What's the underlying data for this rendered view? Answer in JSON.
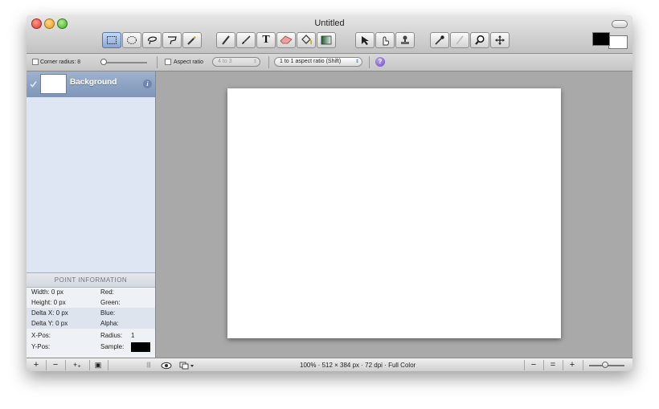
{
  "window": {
    "title": "Untitled"
  },
  "toolbar": {
    "tools": [
      {
        "name": "rect-select-tool-icon",
        "active": true
      },
      {
        "name": "ellipse-select-tool-icon"
      },
      {
        "name": "lasso-tool-icon"
      },
      {
        "name": "polygon-lasso-tool-icon"
      },
      {
        "name": "magic-wand-tool-icon"
      },
      {
        "name": "pencil-tool-icon"
      },
      {
        "name": "brush-tool-icon"
      },
      {
        "name": "text-tool-icon"
      },
      {
        "name": "eraser-tool-icon"
      },
      {
        "name": "paint-bucket-tool-icon"
      },
      {
        "name": "gradient-tool-icon"
      },
      {
        "name": "move-selection-tool-icon"
      },
      {
        "name": "smudge-tool-icon"
      },
      {
        "name": "stamp-tool-icon"
      },
      {
        "name": "eyedropper-tool-icon"
      },
      {
        "name": "retouch-brush-tool-icon"
      },
      {
        "name": "zoom-tool-icon"
      },
      {
        "name": "move-tool-icon"
      }
    ],
    "text_tool_glyph": "T",
    "foreground_color": "#000000",
    "background_color": "#ffffff"
  },
  "options": {
    "corner_radius_label": "Corner radius: 8",
    "aspect_ratio_label": "Aspect ratio",
    "aspect_ratio_value": "4 to 3",
    "ratio_mode_value": "1 to 1 aspect ratio (Shift)",
    "help_glyph": "?"
  },
  "layers": {
    "items": [
      {
        "name": "Background",
        "visible": true
      }
    ]
  },
  "point_info": {
    "header": "POINT INFORMATION",
    "width": "Width:  0 px",
    "height": "Height:  0 px",
    "delta_x": "Delta X: 0 px",
    "delta_y": "Delta Y: 0 px",
    "x_pos": "X-Pos:",
    "y_pos": "Y-Pos:",
    "red": "Red:",
    "green": "Green:",
    "blue": "Blue:",
    "alpha": "Alpha:",
    "radius": "Radius:",
    "radius_value": "1",
    "sample": "Sample:",
    "sample_color": "#000000"
  },
  "bottom": {
    "add": "+",
    "remove": "−",
    "duplicate": "+₊",
    "mask": "▣",
    "grip": "|||",
    "status": "100% · 512 × 384 px · 72 dpi · Full Color",
    "zoom_out": "−",
    "zoom_actual": "=",
    "zoom_in": "+"
  },
  "accent": "#7f96ba"
}
